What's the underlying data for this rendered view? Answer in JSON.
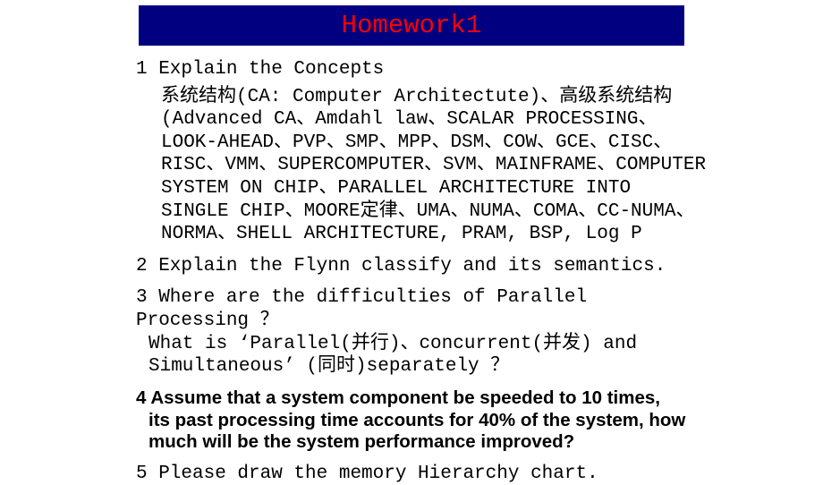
{
  "title": "Homework1",
  "q1": {
    "head": "1  Explain the Concepts",
    "body": "系统结构(CA: Computer Architectute)、高级系统结构(Advanced CA、Amdahl law、SCALAR PROCESSING、LOOK-AHEAD、PVP、SMP、MPP、DSM、COW、GCE、CISC、RISC、VMM、SUPERCOMPUTER、SVM、MAINFRAME、COMPUTER SYSTEM ON CHIP、PARALLEL ARCHITECTURE INTO SINGLE CHIP、MOORE定律、UMA、NUMA、COMA、CC-NUMA、NORMA、SHELL ARCHITECTURE, PRAM, BSP, Log P"
  },
  "q2": "2  Explain the Flynn classify and its semantics.",
  "q3_line1": "3 Where are the difficulties of Parallel Processing ？",
  "q3_line2": "What   is  ‘Parallel(并行)、concurrent(并发)  and Simultaneous’ (同时)separately ？",
  "q4_line1": "4   Assume that a system component be  speeded  to 10 times,",
  "q4_line2": "its past processing time accounts for 40% of the system, how much will be the system performance improved?",
  "q5": "5  Please draw the memory Hierarchy chart."
}
